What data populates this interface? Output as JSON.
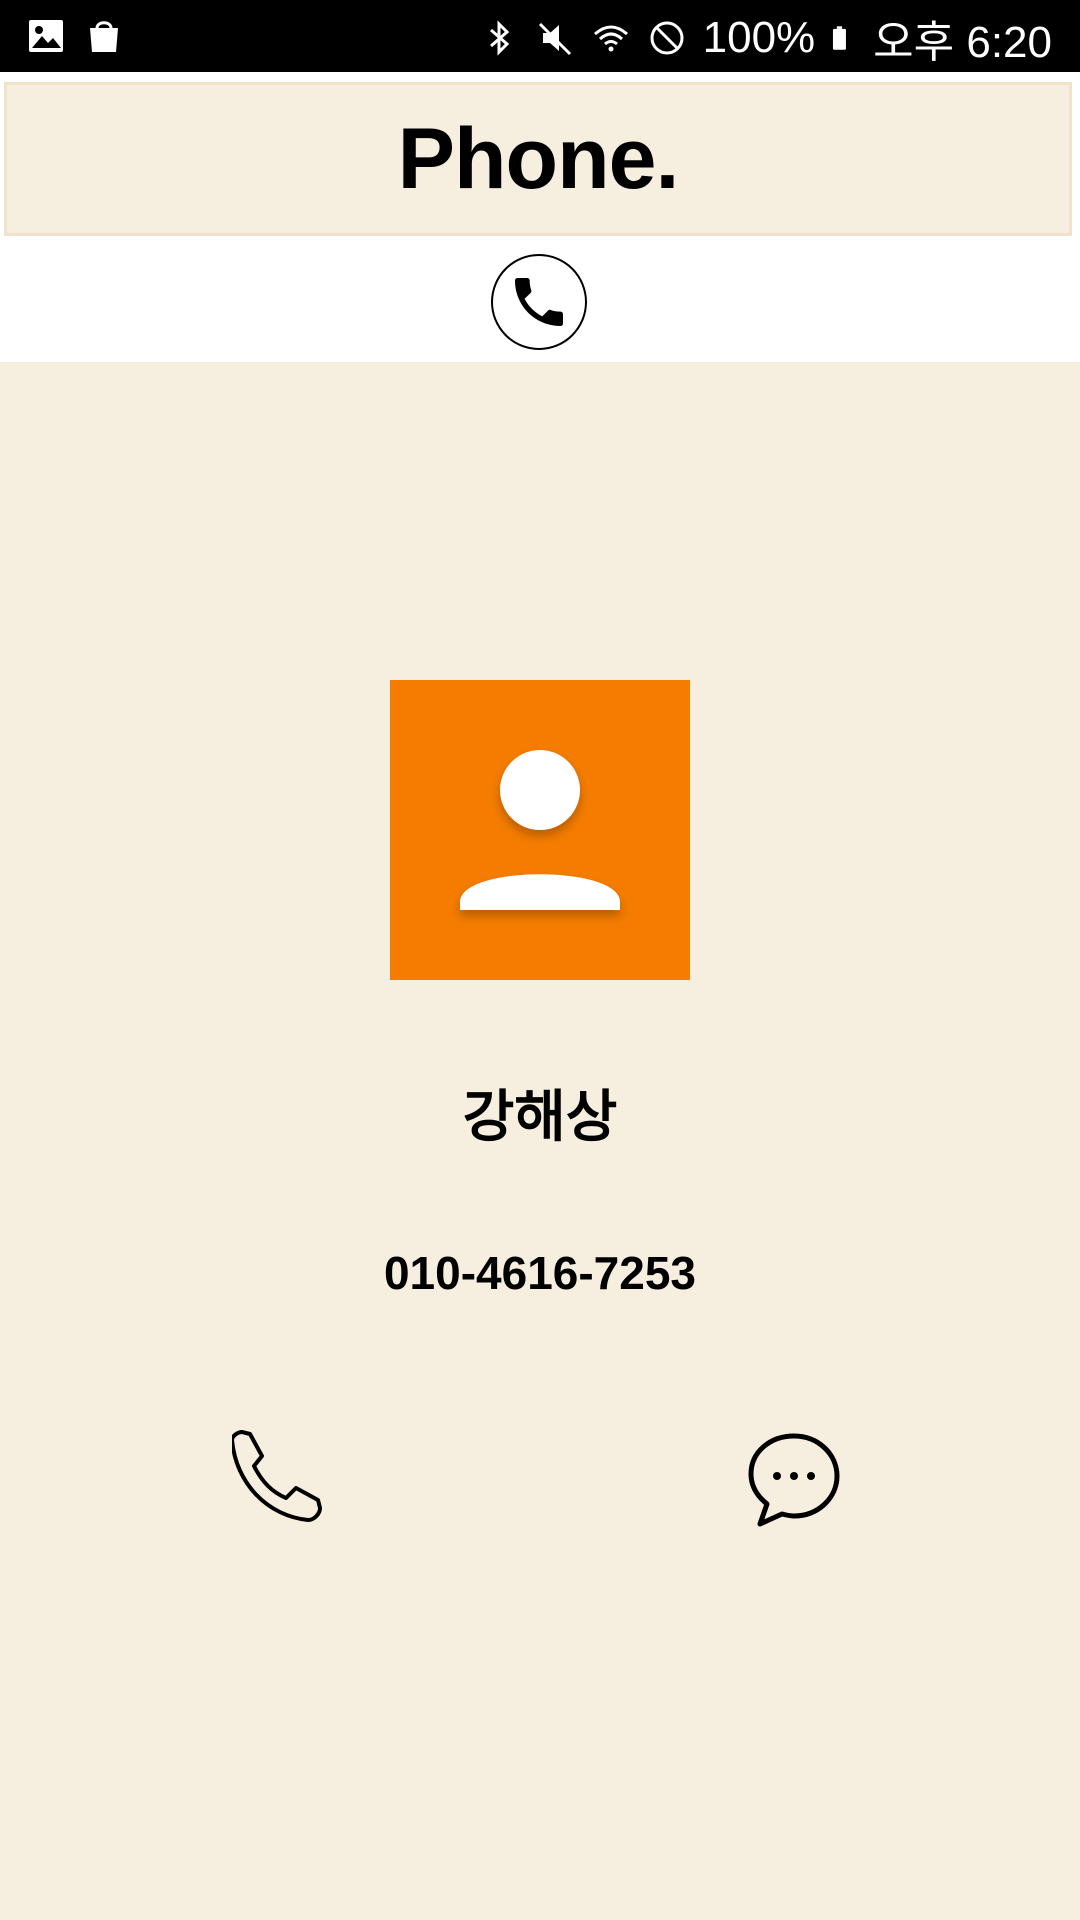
{
  "status_bar": {
    "battery_text": "100%",
    "time_text": "오후 6:20",
    "left_icons": [
      "gallery-icon",
      "shopping-bag-icon"
    ],
    "right_icons": [
      "bluetooth-icon",
      "mute-icon",
      "wifi-icon",
      "do-not-disturb-icon",
      "battery-icon"
    ]
  },
  "header": {
    "title": "Phone.",
    "call_icon": "phone-icon"
  },
  "contact": {
    "name": "강해상",
    "number": "010-4616-7253",
    "avatar_icon": "person-icon",
    "avatar_color": "#f57c00"
  },
  "actions": {
    "call_icon": "call-icon",
    "message_icon": "message-icon"
  },
  "colors": {
    "background": "#f6eedf",
    "status_bar": "#000000",
    "accent": "#f57c00"
  }
}
